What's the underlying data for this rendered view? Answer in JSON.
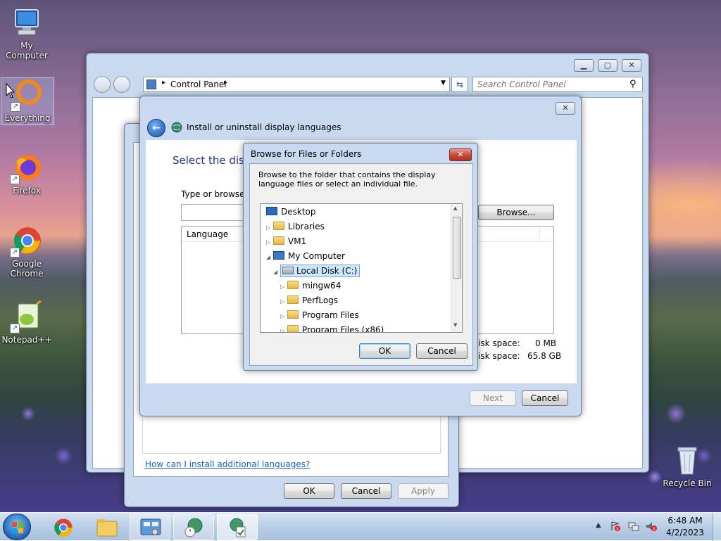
{
  "desktop_icons": {
    "my_computer": "My Computer",
    "everything": "Everything",
    "firefox": "Firefox",
    "chrome": "Google Chrome",
    "notepadpp": "Notepad++",
    "recycle_bin": "Recycle Bin"
  },
  "control_panel": {
    "address": "Control Panel",
    "search_placeholder": "Search Control Panel"
  },
  "region_dialog": {
    "link": "How can I install additional languages?",
    "ok": "OK",
    "cancel": "Cancel",
    "apply": "Apply"
  },
  "wizard": {
    "title": "Install or uninstall display languages",
    "heading": "Select the disp",
    "prompt": "Type or browse t",
    "browse": "Browse...",
    "column_language": "Language",
    "disk_space_label_1": "isk space:",
    "disk_space_value_1": "0 MB",
    "disk_space_label_2": "isk space:",
    "disk_space_value_2": "65.8 GB",
    "next": "Next",
    "cancel": "Cancel"
  },
  "browse_dialog": {
    "title": "Browse for Files or Folders",
    "description": "Browse to the folder that contains the display language files or select an individual file.",
    "tree": {
      "desktop": "Desktop",
      "libraries": "Libraries",
      "vm1": "VM1",
      "my_computer": "My Computer",
      "local_disk": "Local Disk (C:)",
      "mingw64": "mingw64",
      "perflogs": "PerfLogs",
      "program_files": "Program Files",
      "program_files_x86": "Program Files (x86)"
    },
    "ok": "OK",
    "cancel": "Cancel"
  },
  "taskbar": {
    "time": "6:48 AM",
    "date": "4/2/2023"
  },
  "colors": {
    "link": "#1e5dc8",
    "heading": "#1e3287",
    "selection": "#cce8ff",
    "accent_close": "#c7463a"
  }
}
